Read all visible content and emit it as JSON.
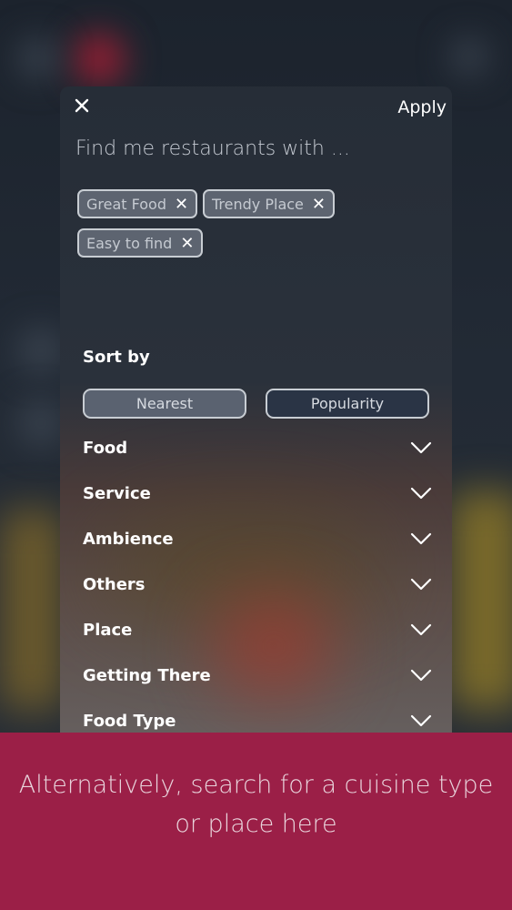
{
  "filter_panel": {
    "close_icon": "close-icon",
    "apply_label": "Apply",
    "query_title": "Find me restaurants with ...",
    "selected_tags": [
      {
        "label": "Great Food",
        "remove_icon": "close-icon"
      },
      {
        "label": "Trendy Place",
        "remove_icon": "close-icon"
      },
      {
        "label": "Easy to find",
        "remove_icon": "close-icon"
      }
    ],
    "sort_by_label": "Sort by",
    "sort_options": [
      {
        "label": "Nearest",
        "selected": true
      },
      {
        "label": "Popularity",
        "selected": false
      }
    ],
    "categories": [
      {
        "label": "Food",
        "icon": "chevron-down-icon"
      },
      {
        "label": "Service",
        "icon": "chevron-down-icon"
      },
      {
        "label": "Ambience",
        "icon": "chevron-down-icon"
      },
      {
        "label": "Others",
        "icon": "chevron-down-icon"
      },
      {
        "label": "Place",
        "icon": "chevron-down-icon"
      },
      {
        "label": "Getting There",
        "icon": "chevron-down-icon"
      },
      {
        "label": "Food Type",
        "icon": "chevron-down-icon"
      }
    ]
  },
  "banner": {
    "text": "Alternatively, search for a cuisine type or place here"
  },
  "colors": {
    "banner_bg": "#9b1f47",
    "panel_bg": "#262d37",
    "chip_bg": "#5d6470",
    "popularity_bg": "#2a3445"
  }
}
